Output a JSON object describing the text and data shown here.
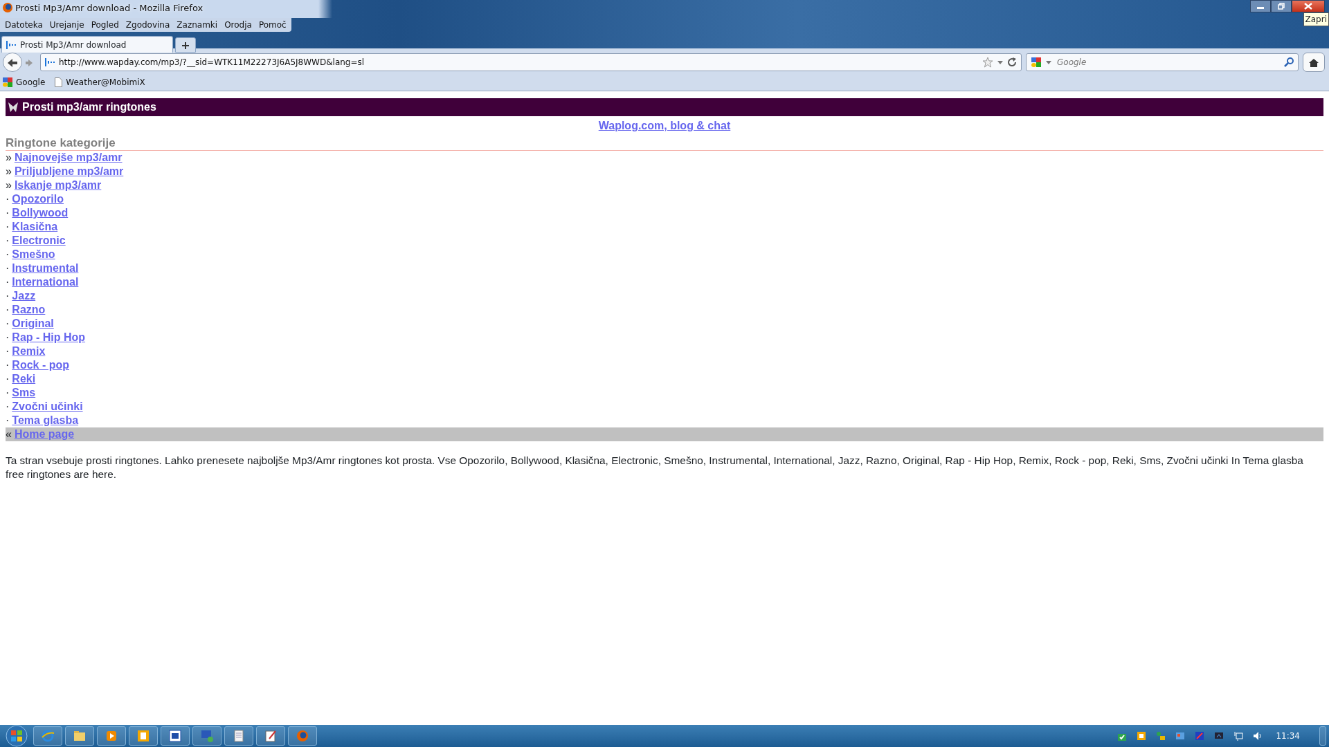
{
  "window": {
    "title": "Prosti Mp3/Amr download - Mozilla Firefox",
    "tooltip": "Zapri"
  },
  "menu": [
    "Datoteka",
    "Urejanje",
    "Pogled",
    "Zgodovina",
    "Zaznamki",
    "Orodja",
    "Pomoč"
  ],
  "tabs": [
    {
      "label": "Prosti Mp3/Amr download",
      "selected": true
    }
  ],
  "address_bar": {
    "url": "http://www.wapday.com/mp3/?__sid=WTK11M22273J6A5J8WWD&lang=sl"
  },
  "search": {
    "placeholder": "Google"
  },
  "bookmarks": [
    "Google",
    "Weather@MobimiX"
  ],
  "page": {
    "header": "Prosti mp3/amr ringtones",
    "top_link": "Waplog.com, blog & chat",
    "section_title": "Ringtone kategorije",
    "categories": [
      {
        "bullet": "»",
        "label": "Najnovejše mp3/amr"
      },
      {
        "bullet": "»",
        "label": "Priljubljene mp3/amr"
      },
      {
        "bullet": "»",
        "label": "Iskanje mp3/amr"
      },
      {
        "bullet": "·",
        "label": "Opozorilo"
      },
      {
        "bullet": "·",
        "label": "Bollywood"
      },
      {
        "bullet": "·",
        "label": "Klasična"
      },
      {
        "bullet": "·",
        "label": "Electronic"
      },
      {
        "bullet": "·",
        "label": "Smešno"
      },
      {
        "bullet": "·",
        "label": "Instrumental"
      },
      {
        "bullet": "·",
        "label": "International"
      },
      {
        "bullet": "·",
        "label": "Jazz"
      },
      {
        "bullet": "·",
        "label": "Razno"
      },
      {
        "bullet": "·",
        "label": "Original"
      },
      {
        "bullet": "·",
        "label": "Rap - Hip Hop"
      },
      {
        "bullet": "·",
        "label": "Remix"
      },
      {
        "bullet": "·",
        "label": "Rock - pop"
      },
      {
        "bullet": "·",
        "label": "Reki"
      },
      {
        "bullet": "·",
        "label": "Sms"
      },
      {
        "bullet": "·",
        "label": "Zvočni učinki"
      },
      {
        "bullet": "·",
        "label": "Tema glasba"
      }
    ],
    "home_bullet": "«",
    "home_link": "Home page",
    "description": "Ta stran vsebuje prosti ringtones. Lahko prenesete najboljše Mp3/Amr ringtones kot prosta. Vse Opozorilo, Bollywood, Klasična, Electronic, Smešno, Instrumental, International, Jazz, Razno, Original, Rap - Hip Hop, Remix, Rock - pop, Reki, Sms, Zvočni učinki In Tema glasba free ringtones are here."
  },
  "taskbar": {
    "clock": "11:34"
  }
}
